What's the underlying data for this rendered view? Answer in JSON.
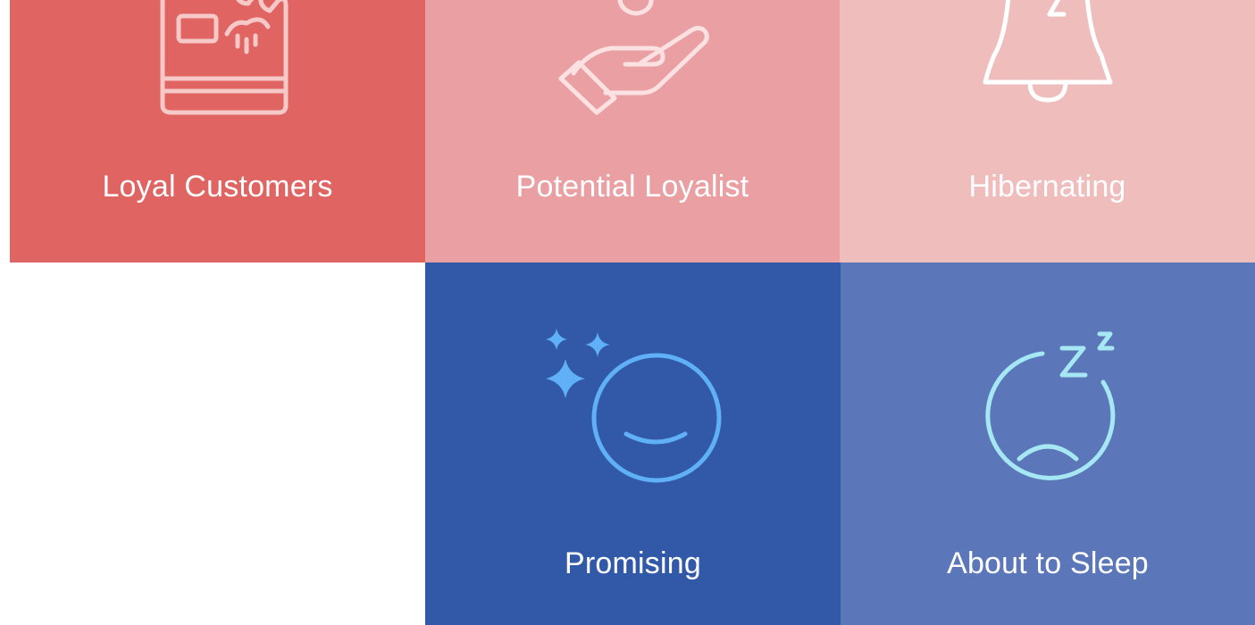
{
  "colors": {
    "loyal_customers": "#e06461",
    "potential_loyalist": "#ea9fa3",
    "hibernating": "#f0bdbd",
    "promising": "#3259a8",
    "about_to_sleep": "#5b76b9",
    "promising_icon": "#5fb0f7",
    "about_to_sleep_icon": "#a5e7f2"
  },
  "tiles": [
    {
      "label": "Loyal Customers",
      "icon": "credit-card-icon"
    },
    {
      "label": "Potential Loyalist",
      "icon": "open-hand-icon"
    },
    {
      "label": "Hibernating",
      "icon": "sleeping-bell-icon"
    },
    {
      "label": "Promising",
      "icon": "smiling-face-sparkles-icon"
    },
    {
      "label": "About to Sleep",
      "icon": "sleepy-sad-face-icon"
    }
  ]
}
